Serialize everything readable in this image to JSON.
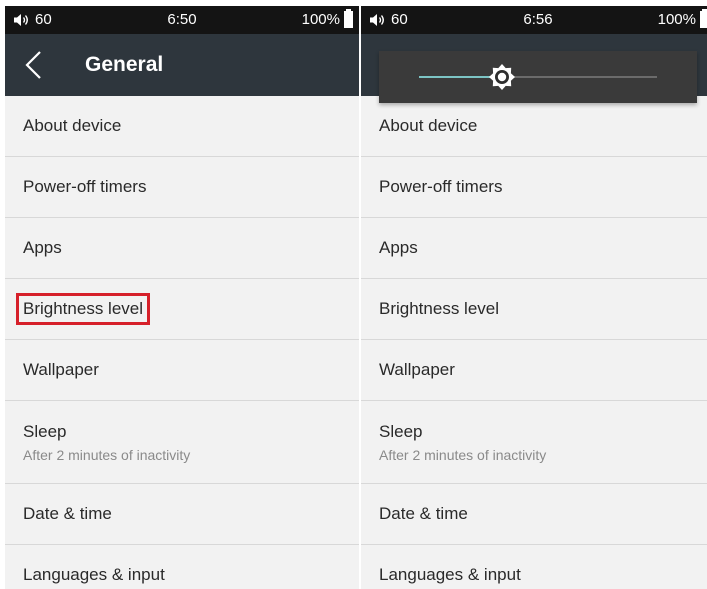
{
  "left": {
    "status": {
      "volume": "60",
      "time": "6:50",
      "battery": "100%"
    },
    "header": {
      "title": "General"
    },
    "items": [
      {
        "label": "About device"
      },
      {
        "label": "Power-off timers"
      },
      {
        "label": "Apps"
      },
      {
        "label": "Brightness level"
      },
      {
        "label": "Wallpaper"
      },
      {
        "label": "Sleep",
        "subtitle": "After 2 minutes of inactivity"
      },
      {
        "label": "Date & time"
      },
      {
        "label": "Languages & input"
      }
    ]
  },
  "right": {
    "status": {
      "volume": "60",
      "time": "6:56",
      "battery": "100%"
    },
    "brightness_slider": {
      "level": 0.35,
      "icon": "brightness-icon"
    },
    "items": [
      {
        "label": "About device"
      },
      {
        "label": "Power-off timers"
      },
      {
        "label": "Apps"
      },
      {
        "label": "Brightness level"
      },
      {
        "label": "Wallpaper"
      },
      {
        "label": "Sleep",
        "subtitle": "After 2 minutes of inactivity"
      },
      {
        "label": "Date & time"
      },
      {
        "label": "Languages & input"
      }
    ]
  },
  "colors": {
    "status_bar": "#141414",
    "title_bar": "#2e363d",
    "highlight_box": "#d6202a",
    "slider_fill": "#7cc4c4",
    "popup_bg": "#3a3a3a"
  }
}
